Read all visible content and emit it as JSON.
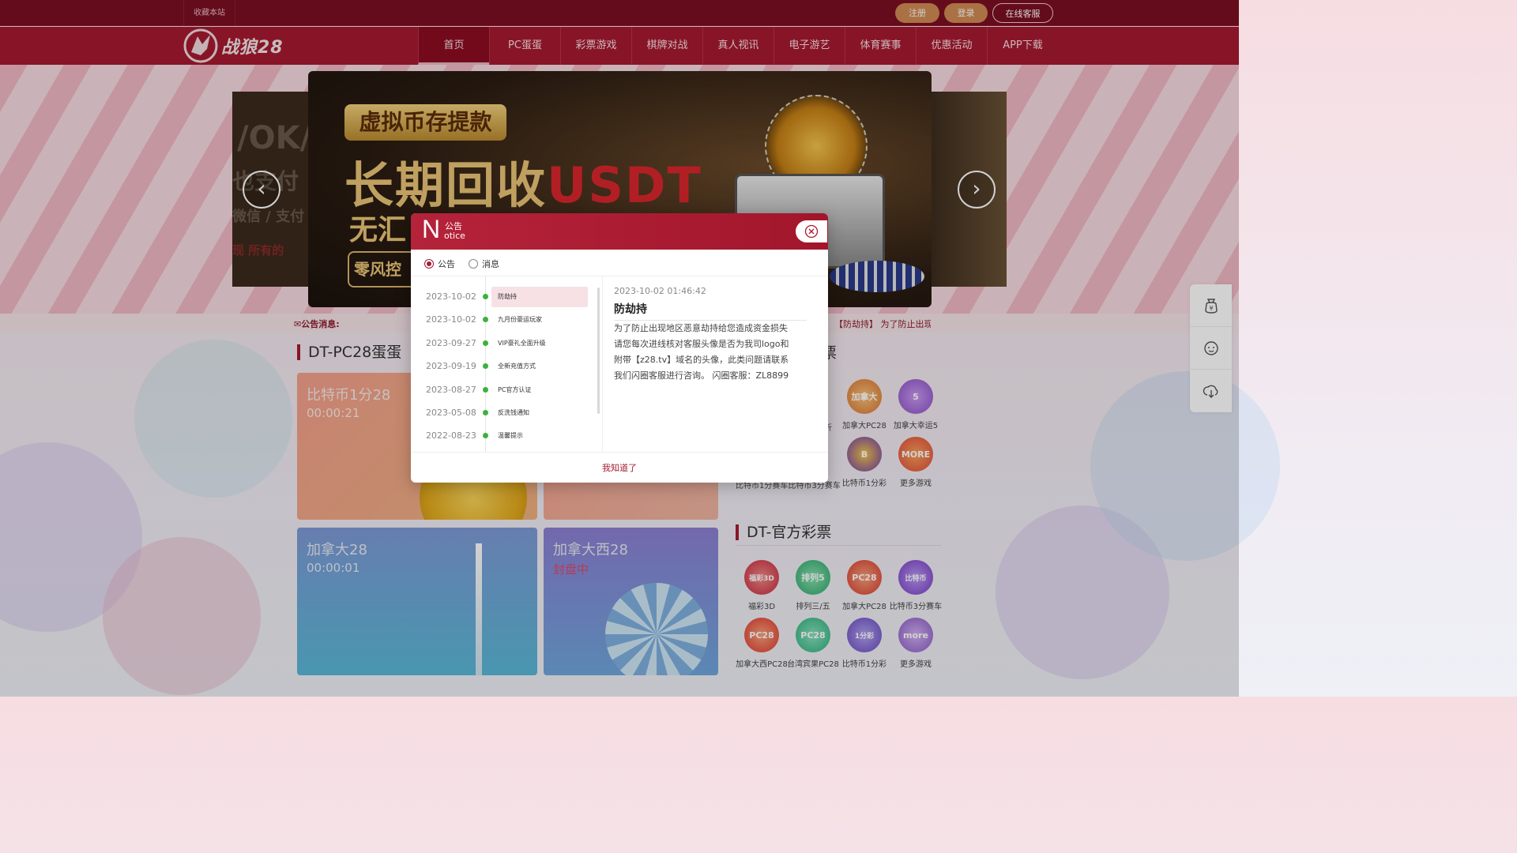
{
  "topbar": {
    "favorite": "收藏本站",
    "register": "注册",
    "login": "登录",
    "support": "在线客服"
  },
  "logo": {
    "text": "战狼28"
  },
  "nav": [
    "首页",
    "PC蛋蛋",
    "彩票游戏",
    "棋牌对战",
    "真人视讯",
    "电子游艺",
    "体育赛事",
    "优惠活动",
    "APP下载"
  ],
  "banner": {
    "pill": "虚拟币存提款",
    "headline_a": "长期回收",
    "headline_b": "USDT",
    "line2": "无汇",
    "badge": "零风控",
    "left_text_1": "/OK/",
    "left_text_2": "也支付",
    "left_text_3": "微信 / 支付",
    "left_text_4": "现 所有的"
  },
  "notice_strip": {
    "label": "公告消息:",
    "marquee": "【防劫持】 为了防止出现"
  },
  "section1": {
    "title": "DT-PC28蛋蛋"
  },
  "section2": {
    "title": "DT-官方彩票"
  },
  "partial_title": "票",
  "cards": [
    {
      "name": "比特币1分28",
      "time": "00:00:21"
    },
    {
      "name": "",
      "time": ""
    },
    {
      "name": "加拿大28",
      "time": "00:00:01"
    },
    {
      "name": "加拿大西28",
      "time": "封盘中"
    }
  ],
  "lottery_top": [
    {
      "label": "加拿大PC28",
      "icon": "maple-tower",
      "color": "#d9722e",
      "caption": "加拿大"
    },
    {
      "label": "加拿大幸运5",
      "icon": "number-5",
      "color": "#8a4fc8",
      "caption": "5"
    }
  ],
  "lottery_top_row2": [
    {
      "label": "比特币1分彩",
      "icon": "bitcoin-ball",
      "color": "#6a3ab0",
      "caption": "B"
    },
    {
      "label": "更多游戏",
      "icon": "more",
      "color": "#e2483a",
      "caption": "MORE"
    }
  ],
  "partial_labels": {
    "row1": "折",
    "row2": "比特币1分赛车比特币3分赛车"
  },
  "lottery_official": [
    {
      "label": "福彩3D",
      "icon": "fucai-3d",
      "color": "#c8283a",
      "caption": "福彩3D"
    },
    {
      "label": "排列三/五",
      "icon": "pailie",
      "color": "#2ca86a",
      "caption": "排列5"
    },
    {
      "label": "加拿大PC28",
      "icon": "pc28-canada",
      "color": "#d93a2e",
      "caption": "PC28"
    },
    {
      "label": "比特币3分赛车",
      "icon": "bitcoin-race",
      "color": "#7a3ac8",
      "caption": "比特币"
    },
    {
      "label": "加拿大西PC28",
      "icon": "pc28-west",
      "color": "#e0382e",
      "caption": "PC28"
    },
    {
      "label": "台湾宾果PC28",
      "icon": "pc28-taiwan",
      "color": "#2eb27a",
      "caption": "PC28"
    },
    {
      "label": "比特币1分彩",
      "icon": "bitcoin-1min",
      "color": "#6a4ac0",
      "caption": "1分彩"
    },
    {
      "label": "更多游戏",
      "icon": "more-games",
      "color": "#8a5ac8",
      "caption": "more"
    }
  ],
  "side_icons": [
    "money-bag-icon",
    "customer-service-icon",
    "download-icon"
  ],
  "modal": {
    "big_letter": "N",
    "title_cn": "公告",
    "title_en": "otice",
    "tab_notice": "公告",
    "tab_message": "消息",
    "items": [
      {
        "date": "2023-10-02",
        "title": "防劫持"
      },
      {
        "date": "2023-10-02",
        "title": "九月份豪运玩家"
      },
      {
        "date": "2023-09-27",
        "title": "VIP豪礼全面升级"
      },
      {
        "date": "2023-09-19",
        "title": "全新充值方式"
      },
      {
        "date": "2023-08-27",
        "title": "PC官方认证"
      },
      {
        "date": "2023-05-08",
        "title": "反洗钱通知"
      },
      {
        "date": "2022-08-23",
        "title": "温馨提示"
      }
    ],
    "detail": {
      "date": "2023-10-02 01:46:42",
      "title": "防劫持",
      "body": "为了防止出现地区恶意劫持给您造成资金损失\n请您每次进线核对客服头像是否为我司logo和\n附带【z28.tv】域名的头像，此类问题请联系\n我们闪圈客服进行咨询。 闪圈客服：ZL8899"
    },
    "confirm": "我知道了"
  },
  "colors": {
    "primary": "#a61a30",
    "topbar": "#7a0f22",
    "accent_orange": "#d08a54",
    "bullet_green": "#3cb13c"
  }
}
